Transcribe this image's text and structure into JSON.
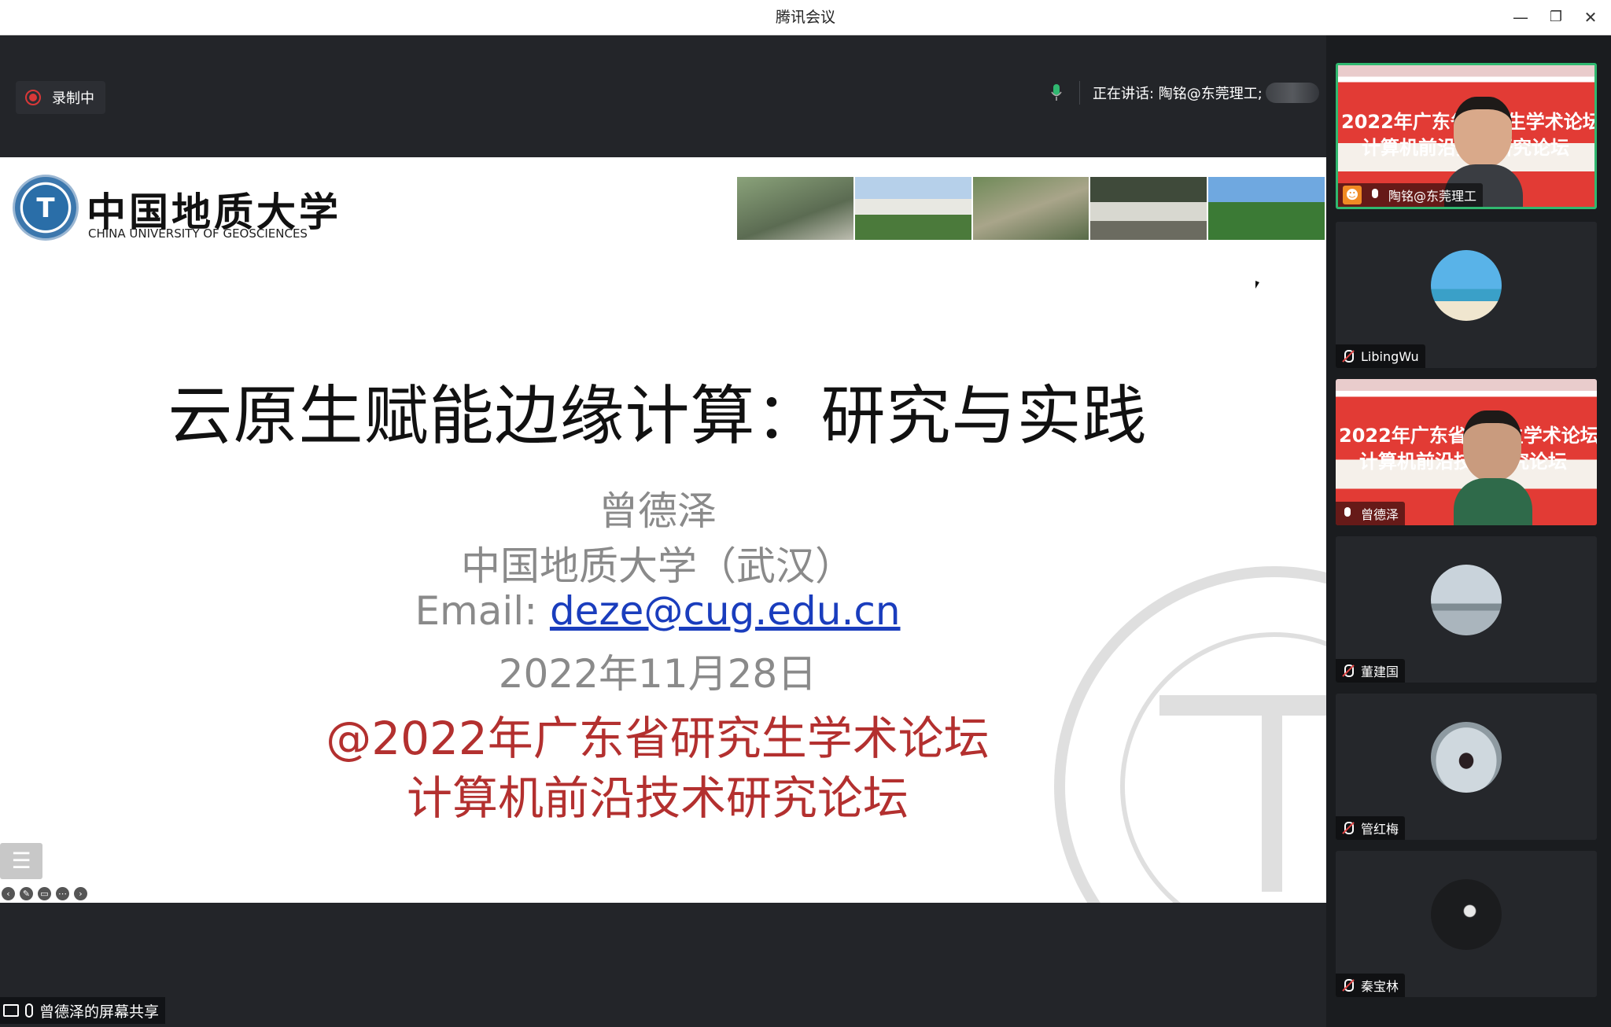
{
  "window": {
    "title": "腾讯会议",
    "minimize": "—",
    "restore": "❐",
    "close": "✕"
  },
  "recording": {
    "label": "录制中"
  },
  "speaking": {
    "label": "正在讲话: 陶铭@东莞理工;"
  },
  "slide": {
    "university_cn": "中国地质大学",
    "university_en": "CHINA UNIVERSITY OF GEOSCIENCES",
    "title": "云原生赋能边缘计算：研究与实践",
    "presenter": "曾德泽",
    "affiliation": "中国地质大学（武汉）",
    "email_label": "Email: ",
    "email": "deze@cug.edu.cn",
    "date": "2022年11月28日",
    "forum_line1": "@2022年广东省研究生学术论坛",
    "forum_line2": "计算机前沿技术研究论坛",
    "menu_icon": "list-icon"
  },
  "participants": [
    {
      "name": "陶铭@东莞理工",
      "mic": "on",
      "video": true,
      "active": true
    },
    {
      "name": "LibingWu",
      "mic": "muted",
      "video": false
    },
    {
      "name": "曾德泽",
      "mic": "on",
      "video": true
    },
    {
      "name": "董建国",
      "mic": "muted",
      "video": false
    },
    {
      "name": "管红梅",
      "mic": "muted",
      "video": false
    },
    {
      "name": "秦宝林",
      "mic": "muted",
      "video": false
    }
  ],
  "poster": {
    "line1": "2022年广东省研究生学术论坛",
    "line2": "计算机前沿技术研究论坛"
  },
  "share_status": {
    "label": "曾德泽的屏幕共享"
  },
  "colors": {
    "accent_green": "#30b870",
    "record_red": "#d93838",
    "slide_red": "#b3302f",
    "link_blue": "#1a3dbd"
  }
}
